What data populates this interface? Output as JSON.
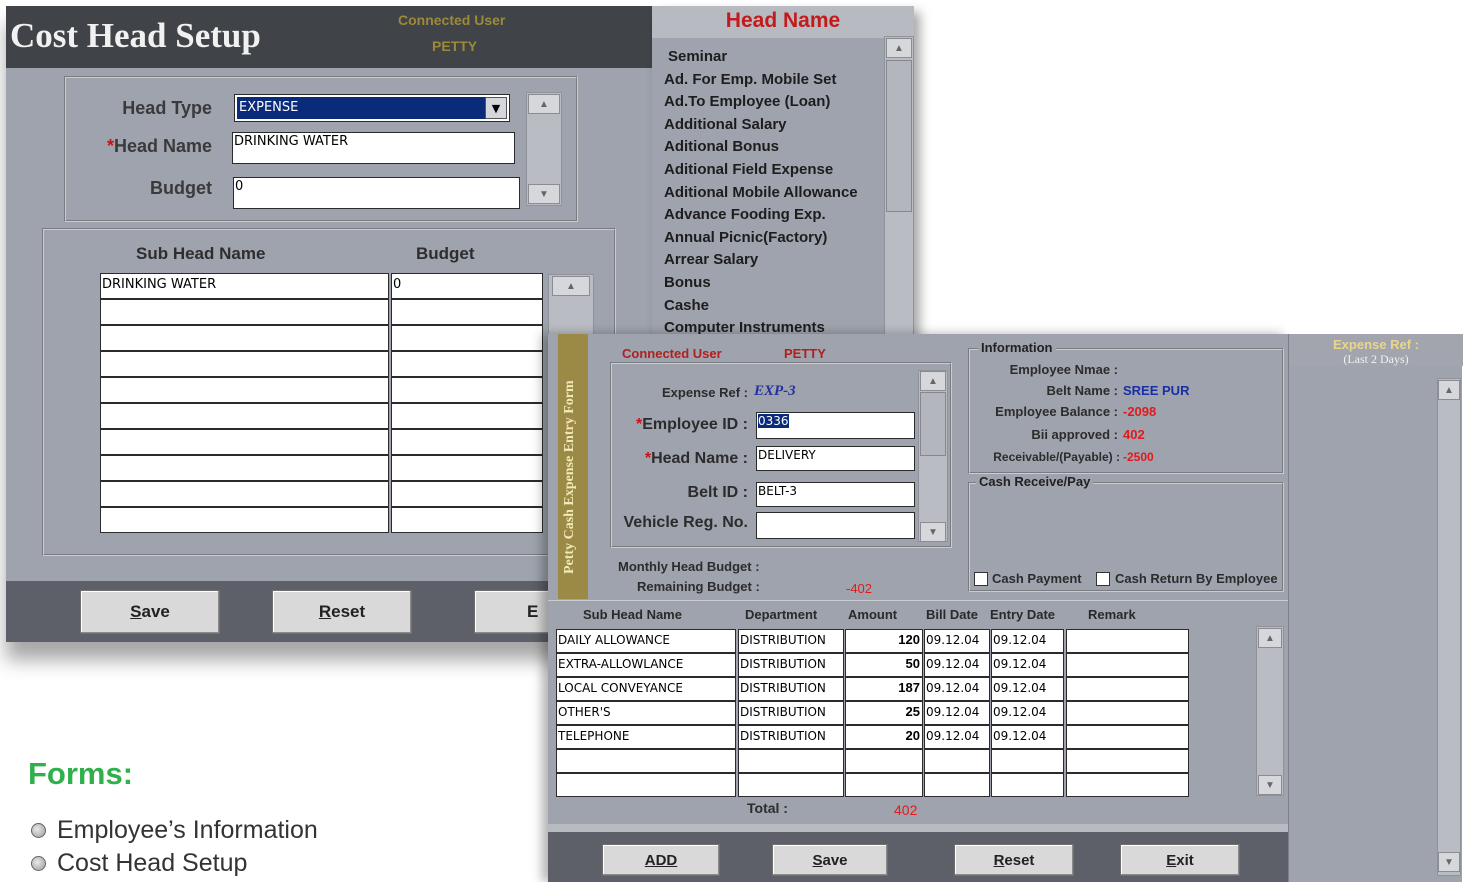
{
  "cost_head": {
    "title": "Cost Head Setup",
    "connected_label": "Connected User",
    "connected_value": "PETTY",
    "head_type_label": "Head Type",
    "head_type_value": "EXPENSE",
    "head_name_star": "*",
    "head_name_label": "Head Name",
    "head_name_value": "DRINKING WATER",
    "budget_label": "Budget",
    "budget_value": "0",
    "col_sub_head": "Sub Head Name",
    "col_budget": "Budget",
    "rows": [
      {
        "name": "DRINKING WATER",
        "budget": "0"
      },
      {
        "name": "",
        "budget": ""
      },
      {
        "name": "",
        "budget": ""
      },
      {
        "name": "",
        "budget": ""
      },
      {
        "name": "",
        "budget": ""
      },
      {
        "name": "",
        "budget": ""
      },
      {
        "name": "",
        "budget": ""
      },
      {
        "name": "",
        "budget": ""
      },
      {
        "name": "",
        "budget": ""
      },
      {
        "name": "",
        "budget": ""
      }
    ],
    "buttons": {
      "save_u": "S",
      "save_rest": "ave",
      "reset_u": "R",
      "reset_rest": "eset",
      "exit": "E"
    }
  },
  "head_list": {
    "header": "Head Name",
    "items": [
      "Seminar",
      "Ad. For Emp. Mobile Set",
      "Ad.To Employee (Loan)",
      "Additional Salary",
      "Aditional Bonus",
      "Aditional Field Expense",
      "Aditional Mobile Allowance",
      "Advance Fooding Exp.",
      "Annual Picnic(Factory)",
      "Arrear Salary",
      "Bonus",
      "Cashe",
      "Computer Instruments"
    ]
  },
  "petty": {
    "sidebar_title": "Petty Cash Expense Entry Form",
    "connected_label": "Connected User",
    "connected_value": "PETTY",
    "expense_ref_label": "Expense Ref :",
    "expense_ref_value": "EXP-3",
    "employee_id_label": "Employee ID :",
    "employee_id_value": "0336",
    "head_name_label": "Head Name :",
    "head_name_value": "DELIVERY",
    "belt_id_label": "Belt ID :",
    "belt_id_value": "BELT-3",
    "vehicle_label": "Vehicle Reg. No.",
    "vehicle_value": "",
    "star": "*",
    "monthly_budget_label": "Monthly Head Budget :",
    "remaining_budget_label": "Remaining Budget :",
    "remaining_budget_value": "-402",
    "info": {
      "title": "Information",
      "employee_name_label": "Employee Nmae :",
      "belt_name_label": "Belt Name :",
      "belt_name_value": "SREE PUR",
      "employee_balance_label": "Employee Balance :",
      "employee_balance_value": "-2098",
      "bill_approved_label": "Bii approved :",
      "bill_approved_value": "402",
      "receivable_label": "Receivable/(Payable) :",
      "receivable_value": "-2500"
    },
    "cash": {
      "title": "Cash Receive/Pay",
      "payment_label": "Cash Payment",
      "return_label": "Cash Return By Employee"
    },
    "columns": [
      "Sub Head Name",
      "Department",
      "Amount",
      "Bill Date",
      "Entry Date",
      "Remark"
    ],
    "rows": [
      {
        "sub": "DAILY ALLOWANCE",
        "dept": "DISTRIBUTION",
        "amount": "120",
        "bill": "09.12.04",
        "entry": "09.12.04",
        "remark": ""
      },
      {
        "sub": "EXTRA-ALLOWLANCE",
        "dept": "DISTRIBUTION",
        "amount": "50",
        "bill": "09.12.04",
        "entry": "09.12.04",
        "remark": ""
      },
      {
        "sub": "LOCAL CONVEYANCE",
        "dept": "DISTRIBUTION",
        "amount": "187",
        "bill": "09.12.04",
        "entry": "09.12.04",
        "remark": ""
      },
      {
        "sub": "OTHER'S",
        "dept": "DISTRIBUTION",
        "amount": "25",
        "bill": "09.12.04",
        "entry": "09.12.04",
        "remark": ""
      },
      {
        "sub": "TELEPHONE",
        "dept": "DISTRIBUTION",
        "amount": "20",
        "bill": "09.12.04",
        "entry": "09.12.04",
        "remark": ""
      },
      {
        "sub": "",
        "dept": "",
        "amount": "",
        "bill": "",
        "entry": "",
        "remark": ""
      },
      {
        "sub": "",
        "dept": "",
        "amount": "",
        "bill": "",
        "entry": "",
        "remark": ""
      }
    ],
    "total_label": "Total :",
    "total_value": "402",
    "buttons": {
      "add": "ADD",
      "save_u": "S",
      "save_rest": "ave",
      "reset_u": "R",
      "reset_rest": "eset",
      "exit_u": "E",
      "exit_rest": "xit"
    }
  },
  "expense_ref_panel": {
    "title": "Expense Ref :",
    "subtitle": "(Last 2 Days)"
  },
  "forms": {
    "title": "Forms:",
    "items": [
      "Employee’s Information",
      "Cost Head Setup"
    ]
  },
  "colors": {
    "window_bg": "#9ea3ad",
    "title_bar": "#404347",
    "accent_red": "#e01b1b",
    "accent_green": "#2fb04a",
    "accent_gold": "#9c8a3a"
  }
}
